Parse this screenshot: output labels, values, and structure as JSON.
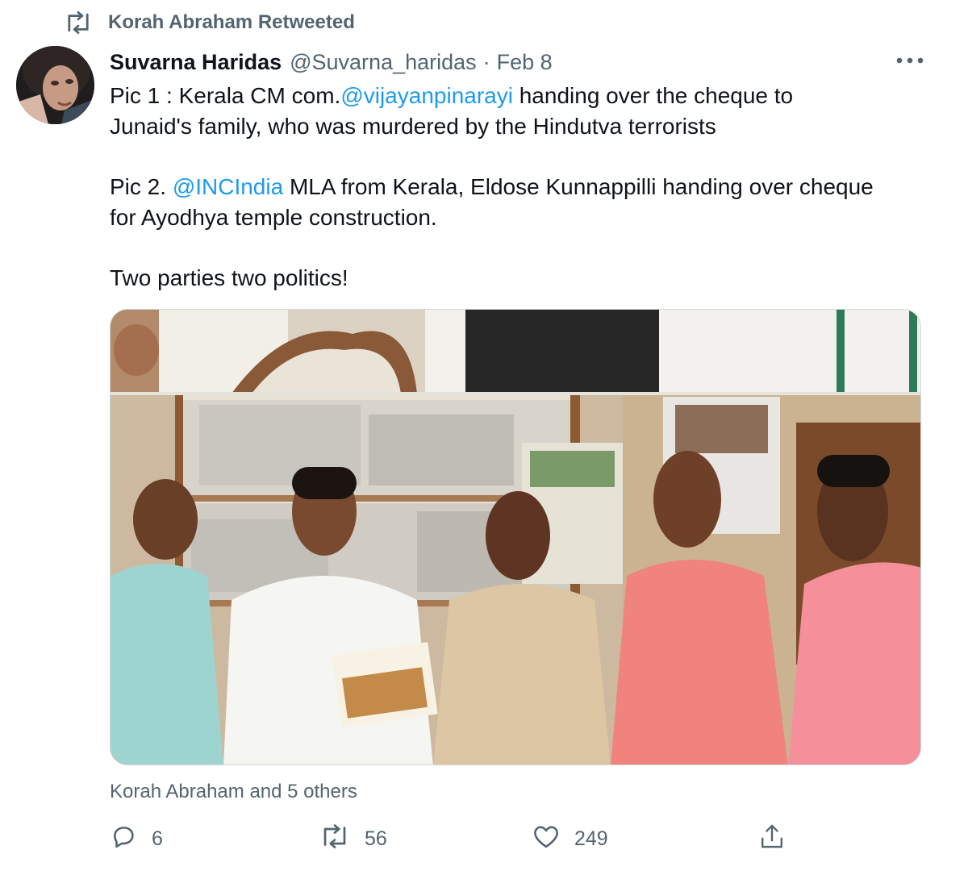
{
  "retweet_banner": {
    "text": "Korah Abraham Retweeted",
    "icon": "retweet-icon"
  },
  "tweet": {
    "author": {
      "display_name": "Suvarna Haridas",
      "handle": "@Suvarna_haridas",
      "avatar_icon": "avatar"
    },
    "separator": "·",
    "date": "Feb 8",
    "more_icon": "more-icon",
    "text": {
      "p1_a": "Pic 1 : Kerala CM com.",
      "p1_mention": "@vijayanpinarayi",
      "p1_b": " handing over the cheque to",
      "p1_line2": "Junaid's family, who was murdered by the Hindutva terrorists",
      "p2_a": "Pic 2. ",
      "p2_mention": "@INCIndia",
      "p2_b": " MLA from Kerala, Eldose Kunnappilli handing over cheque",
      "p2_line2": "for Ayodhya temple construction.",
      "p3": "Two parties two politics!"
    },
    "media": {
      "description_icon": "photo"
    },
    "liked_by": "Korah Abraham and 5 others",
    "actions": {
      "reply": {
        "icon": "reply-icon",
        "count": "6"
      },
      "retweet": {
        "icon": "retweet-icon",
        "count": "56"
      },
      "like": {
        "icon": "heart-icon",
        "count": "249"
      },
      "share": {
        "icon": "share-icon"
      }
    }
  },
  "colors": {
    "text_primary": "#0f1419",
    "text_secondary": "#536471",
    "link": "#1d9bf0",
    "border": "#cfd9de"
  }
}
